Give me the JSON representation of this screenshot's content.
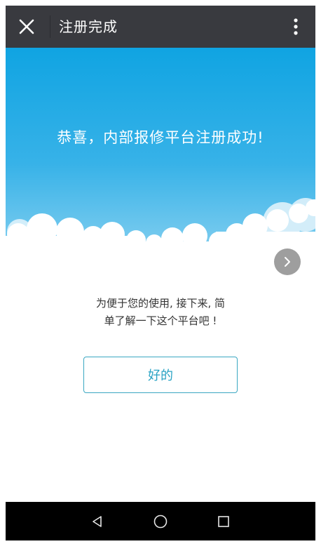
{
  "header": {
    "title": "注册完成"
  },
  "main": {
    "headline": "恭喜，内部报修平台注册成功!",
    "intro_line1": "为便于您的使用, 接下来, 简",
    "intro_line2": "单了解一下这个平台吧 !",
    "ok_label": "好的"
  },
  "icons": {
    "close": "close-icon",
    "more": "more-vertical-icon",
    "next": "chevron-right-icon",
    "nav_back": "back-triangle-icon",
    "nav_home": "home-circle-icon",
    "nav_recents": "recents-square-icon"
  },
  "colors": {
    "topbar": "#393a3f",
    "sky_top": "#12a6e2",
    "sky_bottom": "#79cbef",
    "button_text": "#29a3c4",
    "button_border": "#3aa7c2",
    "next_button": "#9e9e9e",
    "navbar": "#000000"
  }
}
